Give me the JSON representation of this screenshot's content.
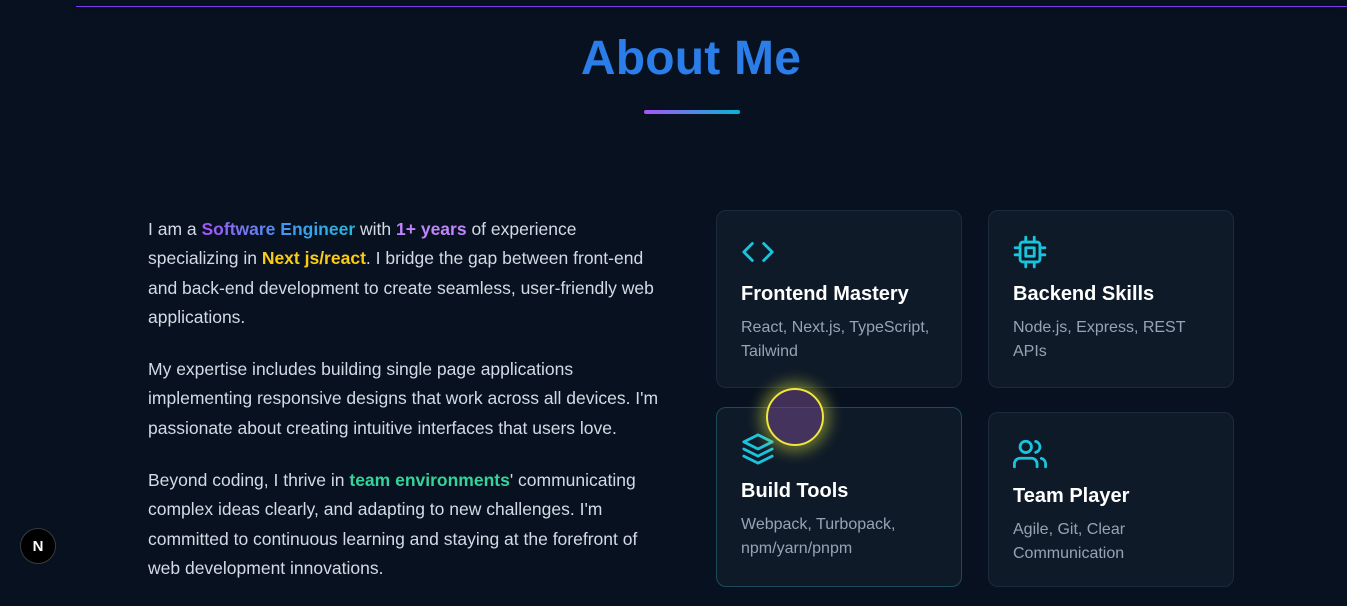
{
  "about": {
    "title": "About Me",
    "p1": {
      "t1": "I am a ",
      "h1": "Software Engineer",
      "t2": " with ",
      "h2": "1+ years",
      "t3": " of experience specializing in ",
      "h3": "Next js/react",
      "t4": ". I bridge the gap between front-end and back-end development to create seamless, user-friendly web applications."
    },
    "p2": "My expertise includes building single page applications implementing responsive designs that work across all devices. I'm passionate about creating intuitive interfaces that users love.",
    "p3": {
      "t1": "Beyond coding, I thrive in ",
      "h1": "team environments",
      "t2": "' communicating complex ideas clearly, and adapting to new challenges. I'm committed to continuous learning and staying at the forefront of web development innovations."
    }
  },
  "cards": [
    {
      "title": "Frontend Mastery",
      "desc": "React, Next.js, TypeScript, Tailwind",
      "icon": "code-icon"
    },
    {
      "title": "Backend Skills",
      "desc": "Node.js, Express, REST APIs",
      "icon": "cpu-chip-icon"
    },
    {
      "title": "Build Tools",
      "desc": "Webpack, Turbopack, npm/yarn/pnpm",
      "icon": "layers-icon"
    },
    {
      "title": "Team Player",
      "desc": "Agile, Git, Clear Communication",
      "icon": "users-icon"
    }
  ],
  "colors": {
    "background": "#08111f",
    "title": "#2b7de9",
    "accent_cyan": "#19c4dc",
    "accent_purple": "#a855f7",
    "highlight_yellow": "#facc15",
    "highlight_green": "#34d399",
    "card_bg": "#0f1a29"
  },
  "next_badge": {
    "label": "N"
  }
}
